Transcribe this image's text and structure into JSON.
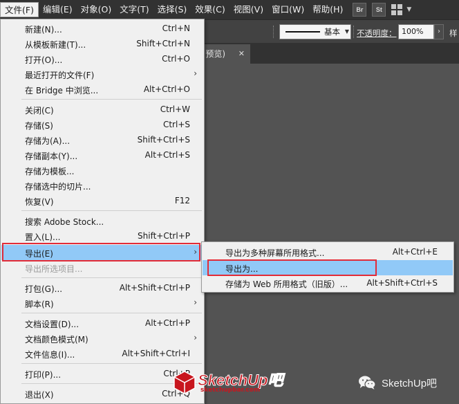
{
  "menubar": {
    "items": [
      "文件(F)",
      "编辑(E)",
      "对象(O)",
      "文字(T)",
      "选择(S)",
      "效果(C)",
      "视图(V)",
      "窗口(W)",
      "帮助(H)"
    ],
    "bridge_label": "Br",
    "stock_label": "St"
  },
  "controlbar": {
    "stroke_style": "基本",
    "opacity_label": "不透明度：",
    "opacity_value": "100%",
    "style_label": "样"
  },
  "tab": {
    "title": "J 预览)",
    "close": "✕"
  },
  "file_menu": {
    "items": [
      {
        "label": "新建(N)...",
        "shortcut": "Ctrl+N"
      },
      {
        "label": "从模板新建(T)...",
        "shortcut": "Shift+Ctrl+N"
      },
      {
        "label": "打开(O)...",
        "shortcut": "Ctrl+O"
      },
      {
        "label": "最近打开的文件(F)",
        "shortcut": "",
        "submenu": true
      },
      {
        "label": "在 Bridge 中浏览...",
        "shortcut": "Alt+Ctrl+O"
      },
      {
        "label": "关闭(C)",
        "shortcut": "Ctrl+W"
      },
      {
        "label": "存储(S)",
        "shortcut": "Ctrl+S"
      },
      {
        "label": "存储为(A)...",
        "shortcut": "Shift+Ctrl+S"
      },
      {
        "label": "存储副本(Y)...",
        "shortcut": "Alt+Ctrl+S"
      },
      {
        "label": "存储为模板...",
        "shortcut": ""
      },
      {
        "label": "存储选中的切片...",
        "shortcut": ""
      },
      {
        "label": "恢复(V)",
        "shortcut": "F12"
      },
      {
        "label": "搜索 Adobe Stock...",
        "shortcut": ""
      },
      {
        "label": "置入(L)...",
        "shortcut": "Shift+Ctrl+P"
      },
      {
        "label": "导出(E)",
        "shortcut": "",
        "submenu": true
      },
      {
        "label": "导出所选项目...",
        "shortcut": "",
        "disabled": true
      },
      {
        "label": "打包(G)...",
        "shortcut": "Alt+Shift+Ctrl+P"
      },
      {
        "label": "脚本(R)",
        "shortcut": "",
        "submenu": true
      },
      {
        "label": "文档设置(D)...",
        "shortcut": "Alt+Ctrl+P"
      },
      {
        "label": "文档颜色模式(M)",
        "shortcut": "",
        "submenu": true
      },
      {
        "label": "文件信息(I)...",
        "shortcut": "Alt+Shift+Ctrl+I"
      },
      {
        "label": "打印(P)...",
        "shortcut": "Ctrl+P"
      },
      {
        "label": "退出(X)",
        "shortcut": "Ctrl+Q"
      }
    ],
    "submenu_arrow": "›"
  },
  "export_submenu": {
    "items": [
      {
        "label": "导出为多种屏幕所用格式...",
        "shortcut": "Alt+Ctrl+E"
      },
      {
        "label": "导出为...",
        "shortcut": ""
      },
      {
        "label": "存储为 Web 所用格式（旧版）...",
        "shortcut": "Alt+Shift+Ctrl+S"
      }
    ]
  },
  "watermark": {
    "brand": "SketchUp吧",
    "domain": "sketchupbar.com",
    "social_name": "SketchUp吧"
  },
  "colors": {
    "highlight": "#91c9f7",
    "annotation_red": "#e32b37",
    "menu_bg": "#f0f0f0",
    "app_dark": "#323232",
    "canvas": "#535353"
  }
}
